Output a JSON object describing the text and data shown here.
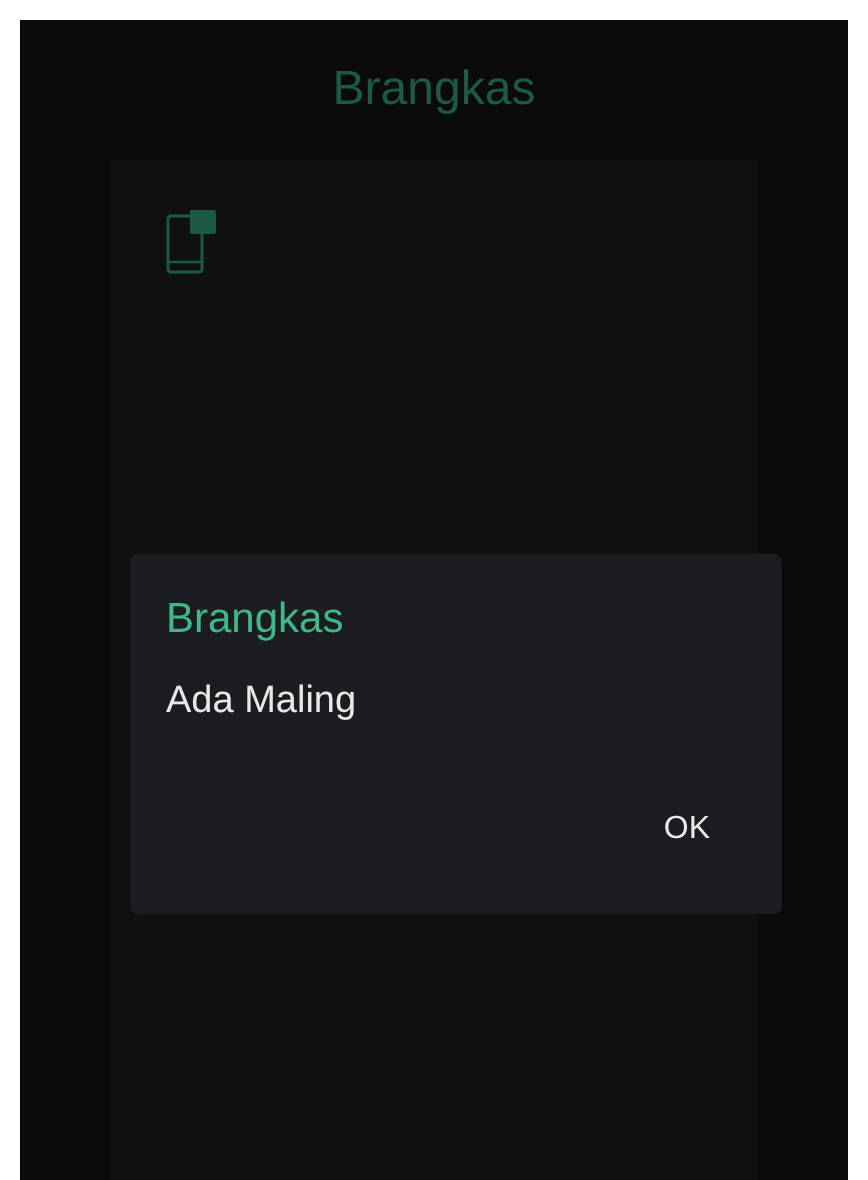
{
  "header": {
    "title": "Brangkas"
  },
  "dialog": {
    "title": "Brangkas",
    "message": "Ada Maling",
    "buttons": [
      "OK"
    ]
  }
}
